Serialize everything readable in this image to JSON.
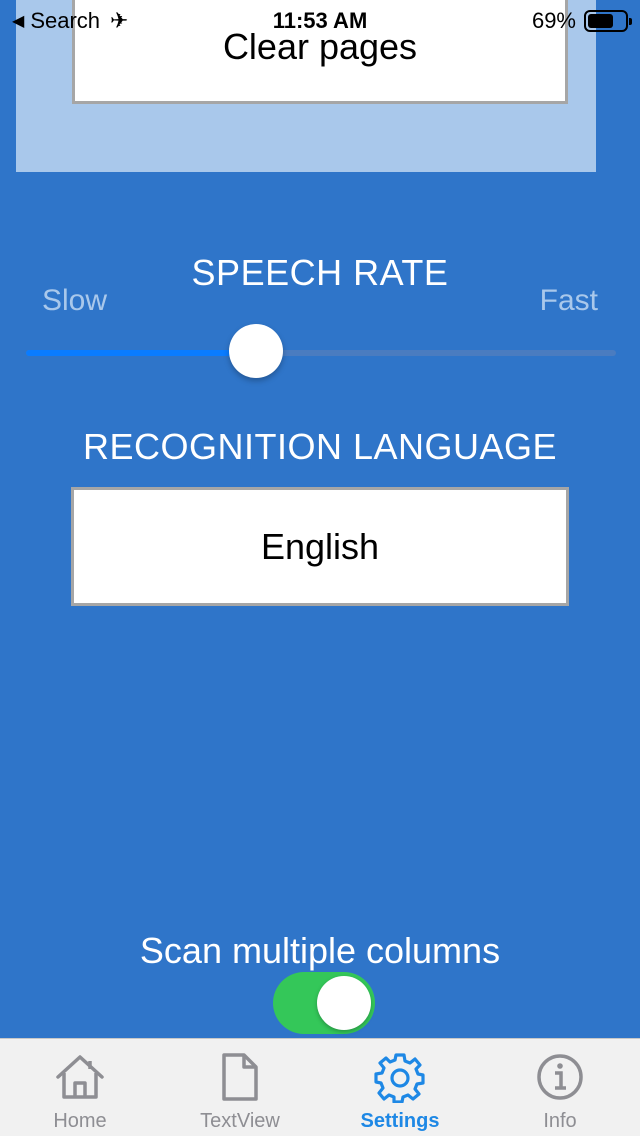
{
  "status_bar": {
    "back_label": "Search",
    "time": "11:53 AM",
    "battery": "69%",
    "battery_level": 0.69
  },
  "clear_pages_label": "Clear pages",
  "speech_rate": {
    "title": "SPEECH RATE",
    "slow_label": "Slow",
    "fast_label": "Fast",
    "value": 0.39
  },
  "recognition_language": {
    "title": "RECOGNITION LANGUAGE",
    "selected": "English"
  },
  "scan_columns": {
    "label": "Scan multiple columns",
    "enabled": true
  },
  "tabs": [
    {
      "label": "Home",
      "icon": "home-icon",
      "active": false
    },
    {
      "label": "TextView",
      "icon": "document-icon",
      "active": false
    },
    {
      "label": "Settings",
      "icon": "gear-icon",
      "active": true
    },
    {
      "label": "Info",
      "icon": "info-icon",
      "active": false
    }
  ],
  "colors": {
    "background": "#2f75c9",
    "panel": "#a9c8eb",
    "slider_fill": "#0a7cff",
    "toggle_on": "#34c759",
    "tab_active": "#1e88e5",
    "tab_inactive": "#8e8e93"
  }
}
